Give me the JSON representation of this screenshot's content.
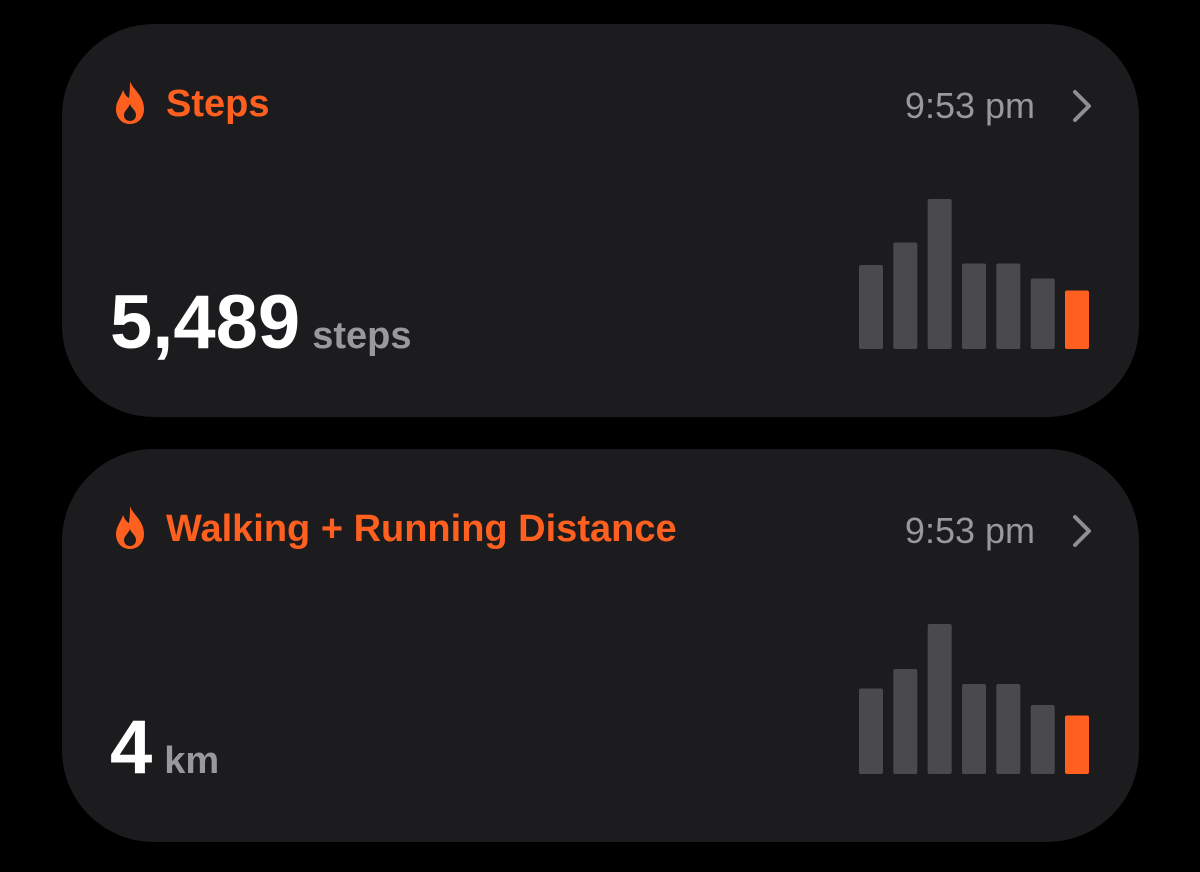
{
  "colors": {
    "accent": "#ff5f1f",
    "bar_inactive": "#4a4a4c",
    "card_bg": "#1c1c1e",
    "secondary_text": "#98989d"
  },
  "cards": [
    {
      "title": "Steps",
      "icon": "flame-icon",
      "time": "9:53 pm",
      "value": "5,489",
      "unit": "steps",
      "chart_data": {
        "type": "bar",
        "values": [
          0.56,
          0.71,
          1.0,
          0.57,
          0.57,
          0.47,
          0.39
        ],
        "highlight_index": 6
      }
    },
    {
      "title": "Walking + Running Distance",
      "icon": "flame-icon",
      "time": "9:53 pm",
      "value": "4",
      "unit": "km",
      "chart_data": {
        "type": "bar",
        "values": [
          0.57,
          0.7,
          1.0,
          0.6,
          0.6,
          0.46,
          0.39
        ],
        "highlight_index": 6
      }
    }
  ]
}
